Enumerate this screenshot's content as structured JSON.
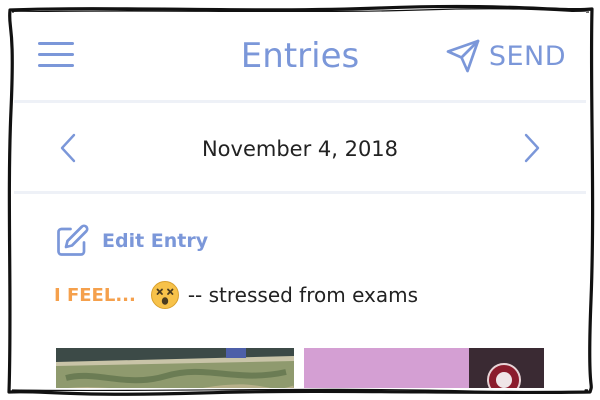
{
  "header": {
    "title": "Entries",
    "send_label": "SEND"
  },
  "date_nav": {
    "date": "November 4, 2018"
  },
  "entry": {
    "edit_label": "Edit Entry",
    "feel_label": "I FEEL...",
    "feel_text": "-- stressed from exams",
    "mood_icon": "dizzy-face-emoji-icon"
  },
  "colors": {
    "accent": "#7b97d9",
    "feel": "#f5a04c",
    "text": "#222222",
    "divider": "#eef1f7"
  }
}
